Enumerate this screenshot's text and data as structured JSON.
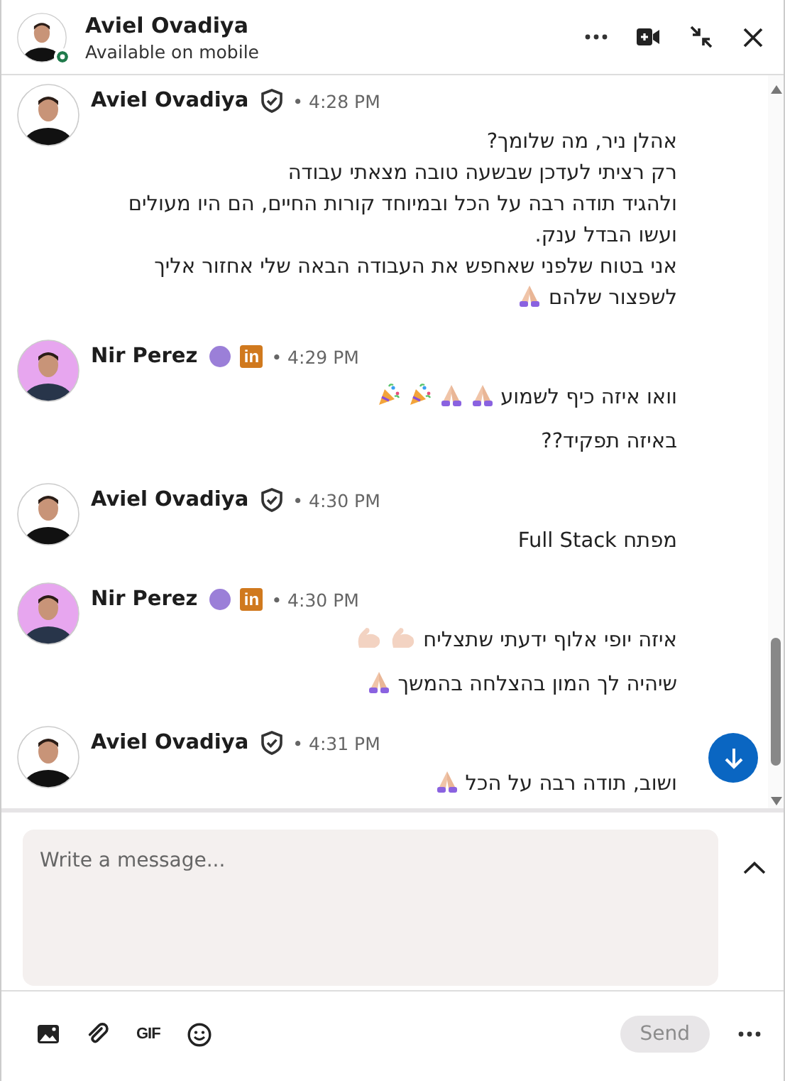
{
  "header": {
    "name": "Aviel Ovadiya",
    "status": "Available on mobile",
    "online": true,
    "kind": "dark"
  },
  "messages": [
    {
      "sender": "Aviel Ovadiya",
      "kind": "dark",
      "badges": [
        {
          "kind": "verified"
        }
      ],
      "time": "• 4:28 PM",
      "lines": [
        {
          "rows": [
            "אהלן ניר, מה שלומך?",
            "רק רציתי לעדכן שבשעה טובה מצאתי עבודה",
            "ולהגיד תודה רבה על הכל ובמיוחד קורות החיים, הם היו מעולים",
            "ועשו הבדל ענק.",
            "אני בטוח שלפני שאחפש את העבודה הבאה שלי אחזור אליך",
            "לשפצור שלהם"
          ],
          "emojis": [
            {
              "kind": "pray"
            }
          ]
        }
      ]
    },
    {
      "sender": "Nir Perez",
      "kind": "purple",
      "badges": [
        {
          "kind": "premium"
        },
        {
          "kind": "linkedin",
          "label": "in"
        }
      ],
      "time": "• 4:29 PM",
      "lines": [
        {
          "rows": [
            "וואו איזה כיף לשמוע"
          ],
          "emojis": [
            {
              "kind": "pray"
            },
            {
              "kind": "pray"
            },
            {
              "kind": "party"
            },
            {
              "kind": "party"
            }
          ]
        },
        {
          "rows": [
            "באיזה תפקיד??"
          ]
        }
      ]
    },
    {
      "sender": "Aviel Ovadiya",
      "kind": "dark",
      "badges": [
        {
          "kind": "verified"
        }
      ],
      "time": "• 4:30 PM",
      "lines": [
        {
          "rows": [
            "מפתח Full Stack"
          ]
        }
      ]
    },
    {
      "sender": "Nir Perez",
      "kind": "purple",
      "badges": [
        {
          "kind": "premium"
        },
        {
          "kind": "linkedin",
          "label": "in"
        }
      ],
      "time": "• 4:30 PM",
      "lines": [
        {
          "rows": [
            "איזה יופי אלוף ידעתי שתצליח"
          ],
          "emojis": [
            {
              "kind": "muscle"
            },
            {
              "kind": "muscle"
            }
          ]
        },
        {
          "rows": [
            "שיהיה לך המון בהצלחה בהמשך"
          ],
          "emojis": [
            {
              "kind": "pray"
            }
          ]
        }
      ]
    },
    {
      "sender": "Aviel Ovadiya",
      "kind": "dark",
      "badges": [
        {
          "kind": "verified"
        }
      ],
      "time": "• 4:31 PM",
      "lines": [
        {
          "rows": [
            "ושוב, תודה רבה על הכל"
          ],
          "emojis": [
            {
              "kind": "pray"
            }
          ]
        }
      ]
    }
  ],
  "composer": {
    "placeholder": "Write a message...",
    "tools": [
      {
        "kind": "image"
      },
      {
        "kind": "attach"
      },
      {
        "kind": "gif",
        "label": "GIF"
      },
      {
        "kind": "emoji"
      }
    ],
    "send": {
      "label": "Send",
      "disabled": true
    }
  }
}
